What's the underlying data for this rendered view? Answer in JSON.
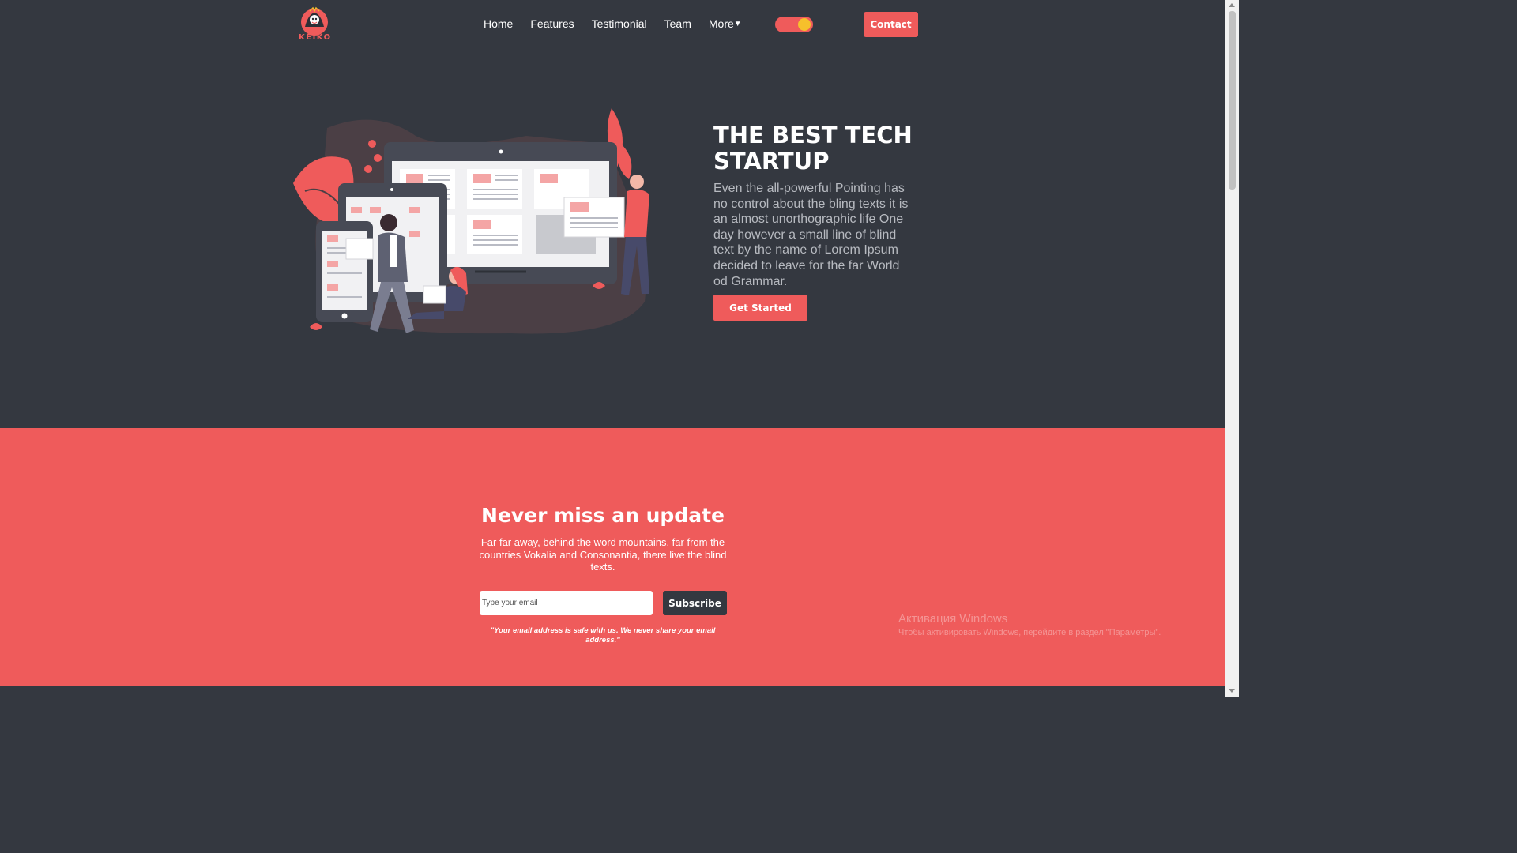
{
  "brand": {
    "name": "KEIKO"
  },
  "nav": {
    "items": [
      {
        "label": "Home"
      },
      {
        "label": "Features"
      },
      {
        "label": "Testimonial"
      },
      {
        "label": "Team"
      },
      {
        "label": "More"
      }
    ],
    "more_caret": "▼",
    "contact_label": "Contact"
  },
  "hero": {
    "title": "THE BEST TECH STARTUP",
    "text": "Even the all-powerful Pointing has no control about the bling texts it is an almost unorthographic life One day however a small line of blind text by the name of Lorem Ipsum decided to leave for the far World od Grammar.",
    "button_label": "Get Started"
  },
  "newsletter": {
    "title": "Never miss an update",
    "text": "Far far away, behind the word mountains, far from the countries Vokalia and Consonantia, there live the blind texts.",
    "email_placeholder": "Type your email",
    "subscribe_label": "Subscribe",
    "note": "\"Your email address is safe with us. We never share your email address.\""
  },
  "watermark": {
    "title": "Активация Windows",
    "subtitle": "Чтобы активировать Windows, перейдите в раздел \"Параметры\"."
  },
  "colors": {
    "background": "#343840",
    "accent": "#ef5b5b",
    "toggle_knob": "#f6c02c"
  }
}
